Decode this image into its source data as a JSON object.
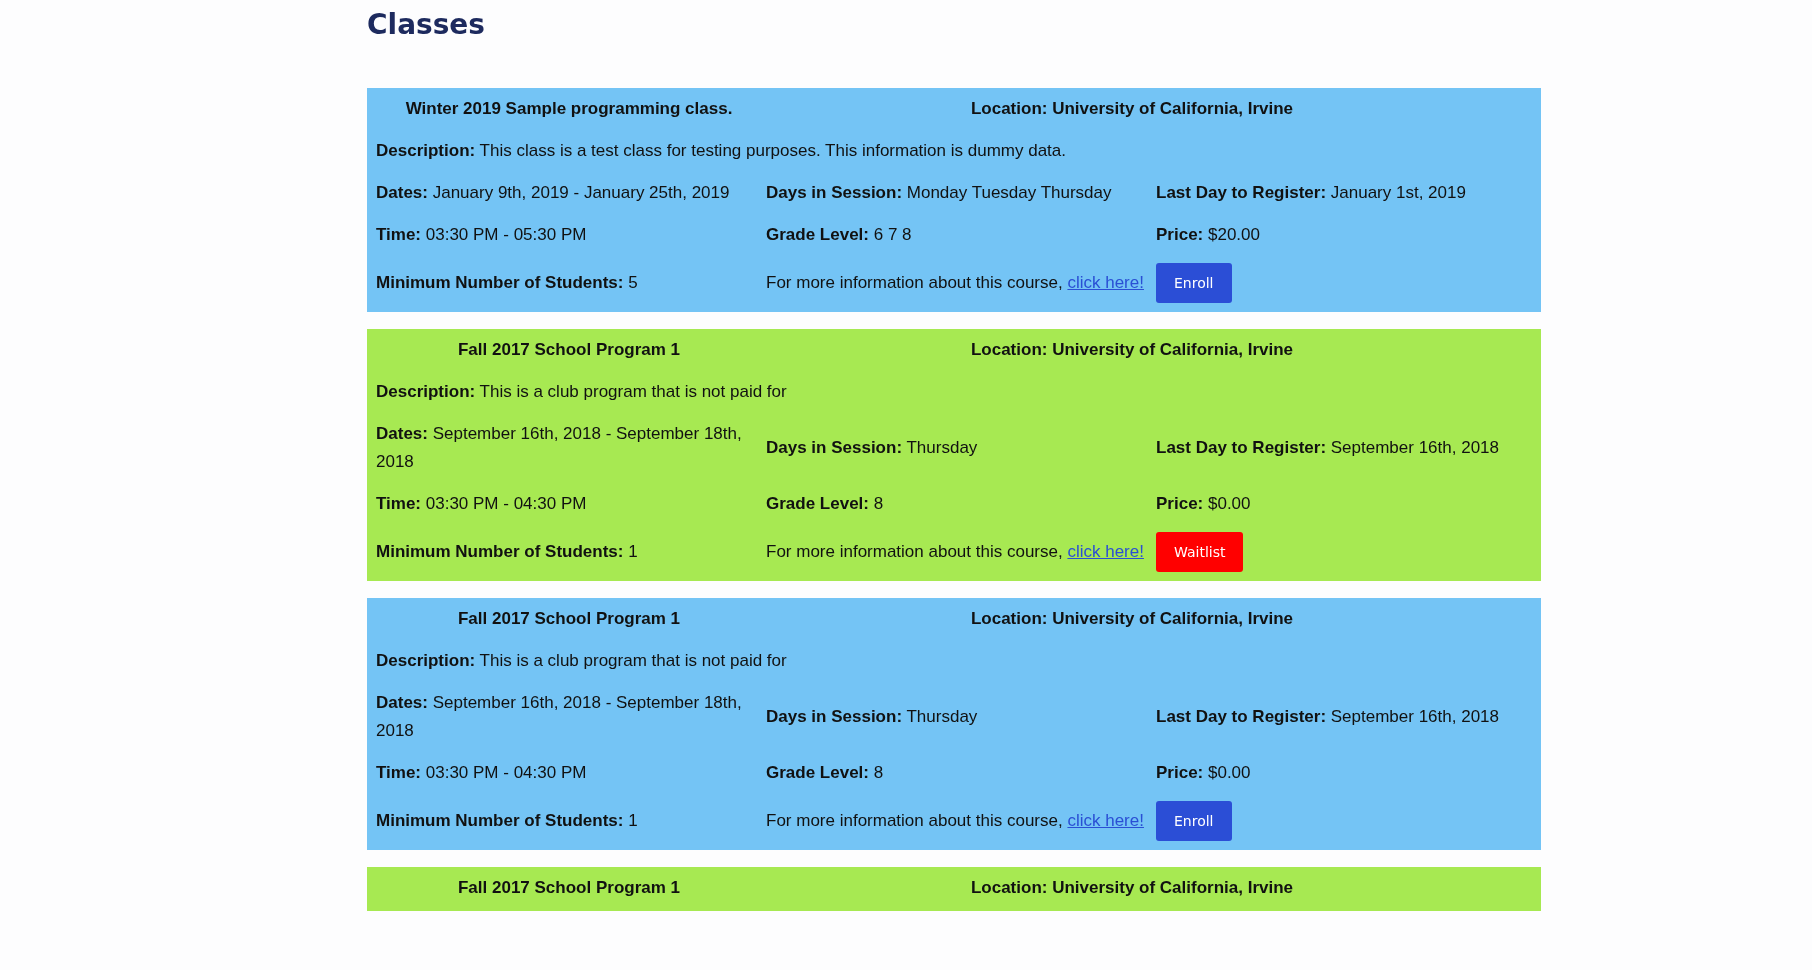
{
  "heading": "Classes",
  "classes": [
    {
      "color": "#74c4f5",
      "title": "Winter 2019 Sample programming class.",
      "location": "Location: University of California, Irvine",
      "description": {
        "label": "Description:",
        "value": "This class is a test class for testing purposes. This information is dummy data."
      },
      "fields": [
        {
          "label": "Dates:",
          "value": "January 9th, 2019 - January 25th, 2019"
        },
        {
          "label": "Days in Session:",
          "value": "Monday Tuesday Thursday"
        },
        {
          "label": "Last Day to Register:",
          "value": "January 1st, 2019"
        },
        {
          "label": "Time:",
          "value": "03:30 PM - 05:30 PM"
        },
        {
          "label": "Grade Level:",
          "value": "6 7 8"
        },
        {
          "label": "Price:",
          "value": "$20.00"
        },
        {
          "label": "Minimum Number of Students:",
          "value": "5"
        }
      ],
      "more_info": "For more information about this course,",
      "link": "click here!",
      "button": {
        "kind": "enroll",
        "label": "Enroll"
      }
    },
    {
      "color": "#a7e952",
      "title": "Fall 2017 School Program 1",
      "location": "Location: University of California, Irvine",
      "description": {
        "label": "Description:",
        "value": "This is a club program that is not paid for"
      },
      "fields": [
        {
          "label": "Dates:",
          "value": "September 16th, 2018 - September 18th, 2018"
        },
        {
          "label": "Days in Session:",
          "value": "Thursday"
        },
        {
          "label": "Last Day to Register:",
          "value": "September 16th, 2018"
        },
        {
          "label": "Time:",
          "value": "03:30 PM - 04:30 PM"
        },
        {
          "label": "Grade Level:",
          "value": "8"
        },
        {
          "label": "Price:",
          "value": "$0.00"
        },
        {
          "label": "Minimum Number of Students:",
          "value": "1"
        }
      ],
      "more_info": "For more information about this course,",
      "link": "click here!",
      "button": {
        "kind": "waitlist",
        "label": "Waitlist"
      }
    },
    {
      "color": "#74c4f5",
      "title": "Fall 2017 School Program 1",
      "location": "Location: University of California, Irvine",
      "description": {
        "label": "Description:",
        "value": "This is a club program that is not paid for"
      },
      "fields": [
        {
          "label": "Dates:",
          "value": "September 16th, 2018 - September 18th, 2018"
        },
        {
          "label": "Days in Session:",
          "value": "Thursday"
        },
        {
          "label": "Last Day to Register:",
          "value": "September 16th, 2018"
        },
        {
          "label": "Time:",
          "value": "03:30 PM - 04:30 PM"
        },
        {
          "label": "Grade Level:",
          "value": "8"
        },
        {
          "label": "Price:",
          "value": "$0.00"
        },
        {
          "label": "Minimum Number of Students:",
          "value": "1"
        }
      ],
      "more_info": "For more information about this course,",
      "link": "click here!",
      "button": {
        "kind": "enroll",
        "label": "Enroll"
      }
    },
    {
      "color": "#a7e952",
      "title": "Fall 2017 School Program 1",
      "location": "Location: University of California, Irvine"
    }
  ]
}
